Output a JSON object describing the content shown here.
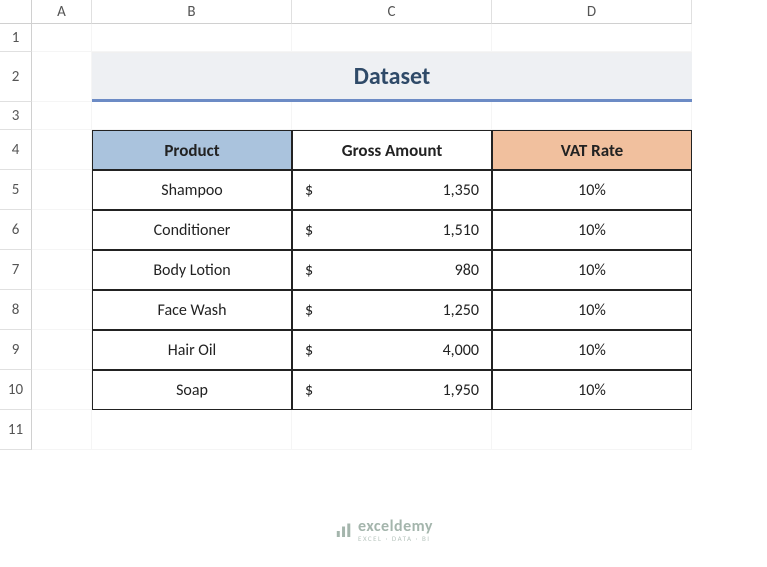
{
  "columns": [
    "A",
    "B",
    "C",
    "D"
  ],
  "rows": [
    "1",
    "2",
    "3",
    "4",
    "5",
    "6",
    "7",
    "8",
    "9",
    "10",
    "11"
  ],
  "title": "Dataset",
  "headers": {
    "product": "Product",
    "gross": "Gross Amount",
    "vat": "VAT Rate"
  },
  "currency_symbol": "$",
  "data": [
    {
      "product": "Shampoo",
      "gross": "1,350",
      "vat": "10%"
    },
    {
      "product": "Conditioner",
      "gross": "1,510",
      "vat": "10%"
    },
    {
      "product": "Body Lotion",
      "gross": "980",
      "vat": "10%"
    },
    {
      "product": "Face Wash",
      "gross": "1,250",
      "vat": "10%"
    },
    {
      "product": "Hair Oil",
      "gross": "4,000",
      "vat": "10%"
    },
    {
      "product": "Soap",
      "gross": "1,950",
      "vat": "10%"
    }
  ],
  "watermark": {
    "brand": "exceldemy",
    "tag": "EXCEL · DATA · BI"
  },
  "chart_data": {
    "type": "table",
    "title": "Dataset",
    "columns": [
      "Product",
      "Gross Amount",
      "VAT Rate"
    ],
    "rows": [
      [
        "Shampoo",
        1350,
        "10%"
      ],
      [
        "Conditioner",
        1510,
        "10%"
      ],
      [
        "Body Lotion",
        980,
        "10%"
      ],
      [
        "Face Wash",
        1250,
        "10%"
      ],
      [
        "Hair Oil",
        4000,
        "10%"
      ],
      [
        "Soap",
        1950,
        "10%"
      ]
    ]
  }
}
